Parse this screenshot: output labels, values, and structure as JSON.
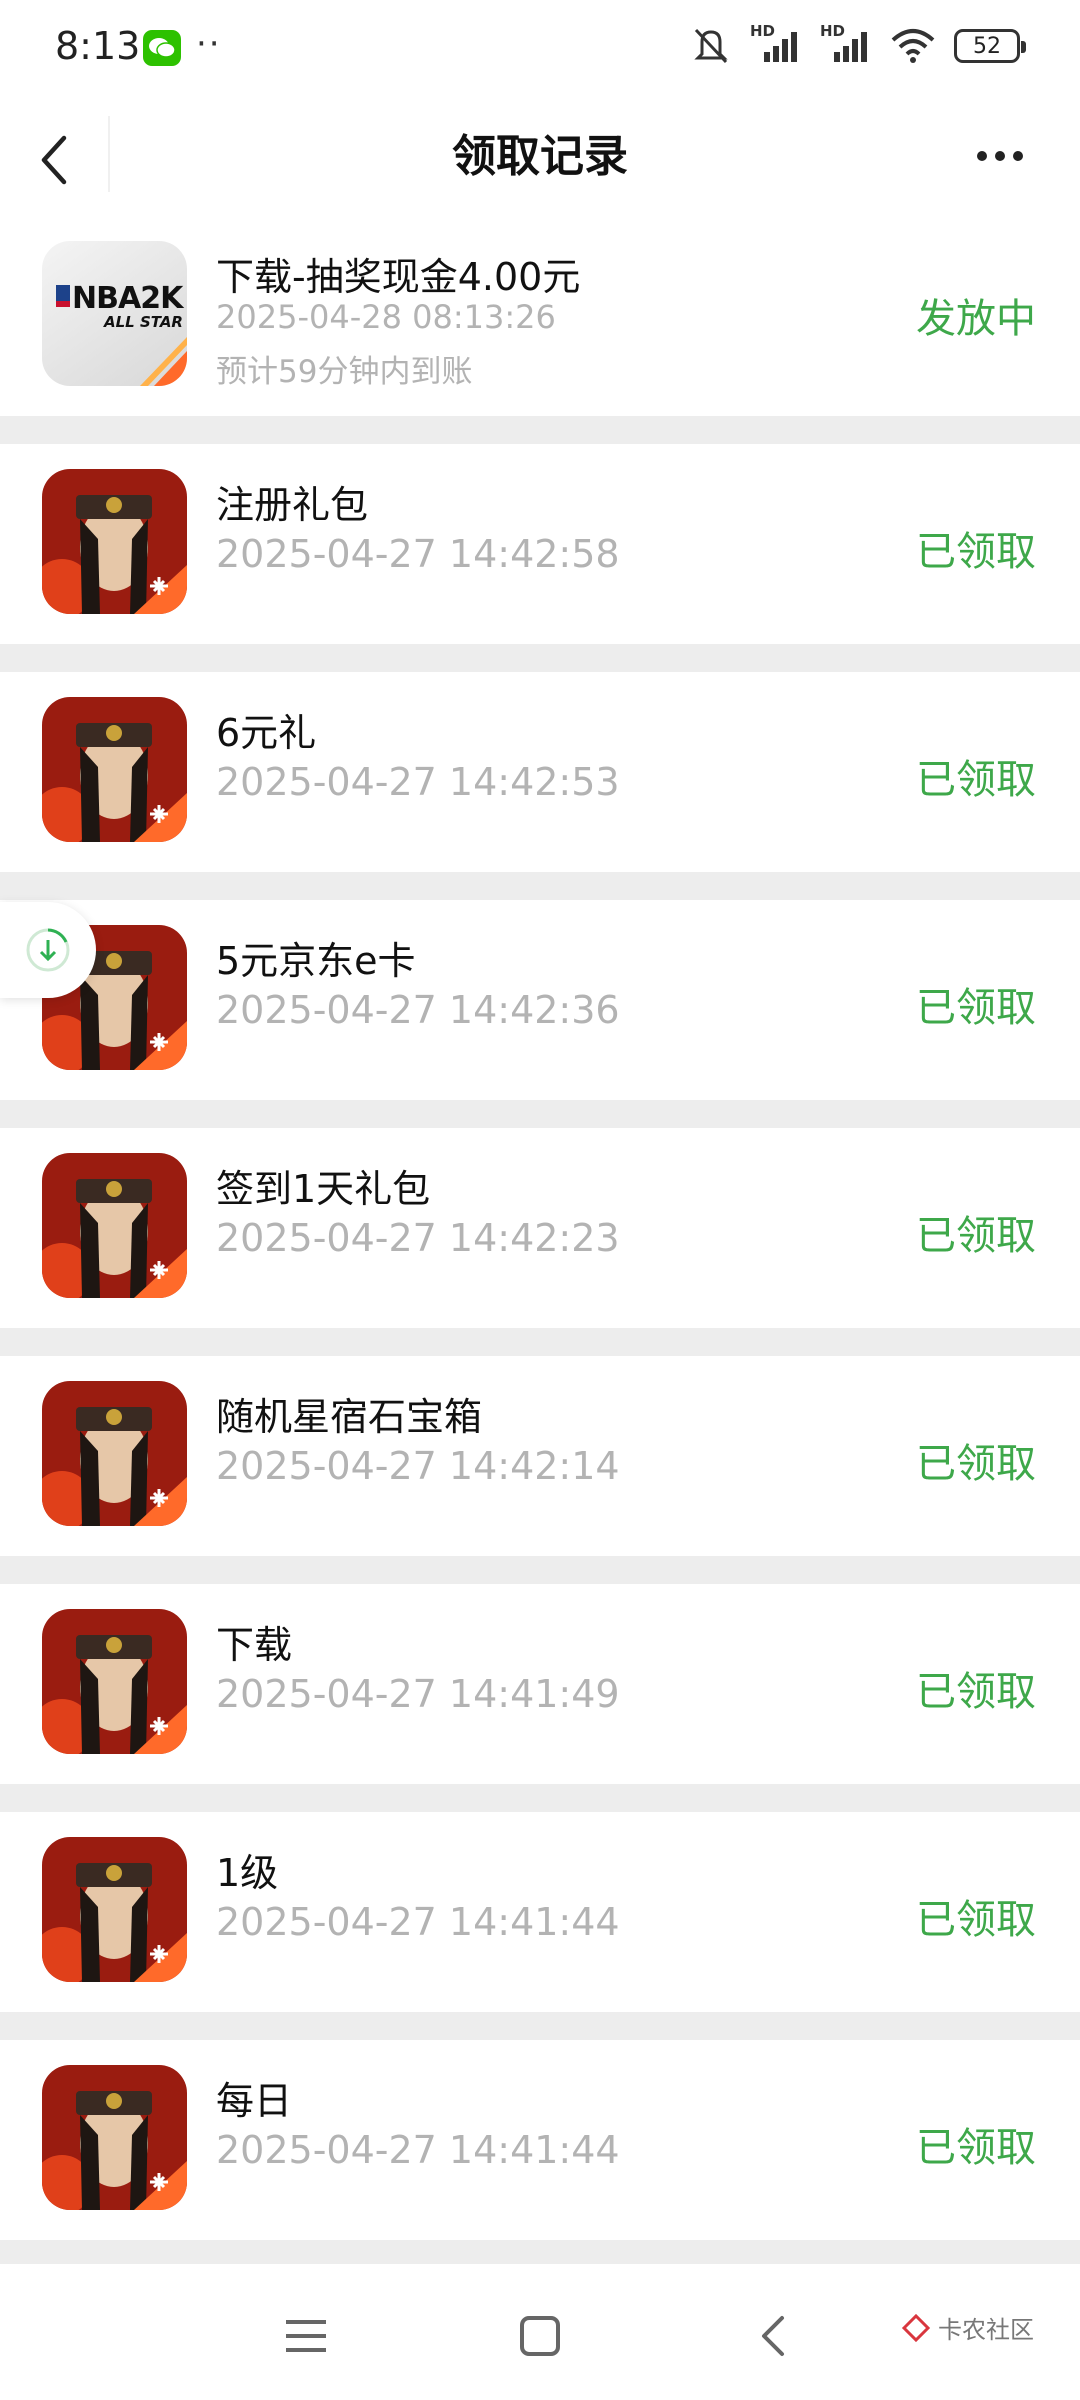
{
  "status_bar": {
    "time": "8:13",
    "dots": "··",
    "signal_label_1": "HD",
    "signal_label_2": "HD",
    "battery": "52"
  },
  "nav": {
    "title": "领取记录"
  },
  "icons": {
    "nba_text": "NBA2K",
    "nba_sub": "ALL STAR"
  },
  "records": [
    {
      "title": "下载-抽奖现金4.00元",
      "time": "2025-04-28 08:13:26",
      "note": "预计59分钟内到账",
      "status": "发放中",
      "icon": "nba2k-allstar-icon"
    },
    {
      "title": "注册礼包",
      "time": "2025-04-27 14:42:58",
      "status": "已领取",
      "icon": "game-hero-icon"
    },
    {
      "title": "6元礼",
      "time": "2025-04-27 14:42:53",
      "status": "已领取",
      "icon": "game-hero-icon"
    },
    {
      "title": "5元京东e卡",
      "time": "2025-04-27 14:42:36",
      "status": "已领取",
      "icon": "game-hero-icon"
    },
    {
      "title": "签到1天礼包",
      "time": "2025-04-27 14:42:23",
      "status": "已领取",
      "icon": "game-hero-icon"
    },
    {
      "title": "随机星宿石宝箱",
      "time": "2025-04-27 14:42:14",
      "status": "已领取",
      "icon": "game-hero-icon"
    },
    {
      "title": "下载",
      "time": "2025-04-27 14:41:49",
      "status": "已领取",
      "icon": "game-hero-icon"
    },
    {
      "title": "1级",
      "time": "2025-04-27 14:41:44",
      "status": "已领取",
      "icon": "game-hero-icon"
    },
    {
      "title": "每日",
      "time": "2025-04-27 14:41:44",
      "status": "已领取",
      "icon": "game-hero-icon"
    }
  ],
  "watermark": "卡农社区",
  "colors": {
    "status_green": "#3ea84a",
    "time_gray": "#b3b3b3",
    "separator": "#ededed"
  }
}
